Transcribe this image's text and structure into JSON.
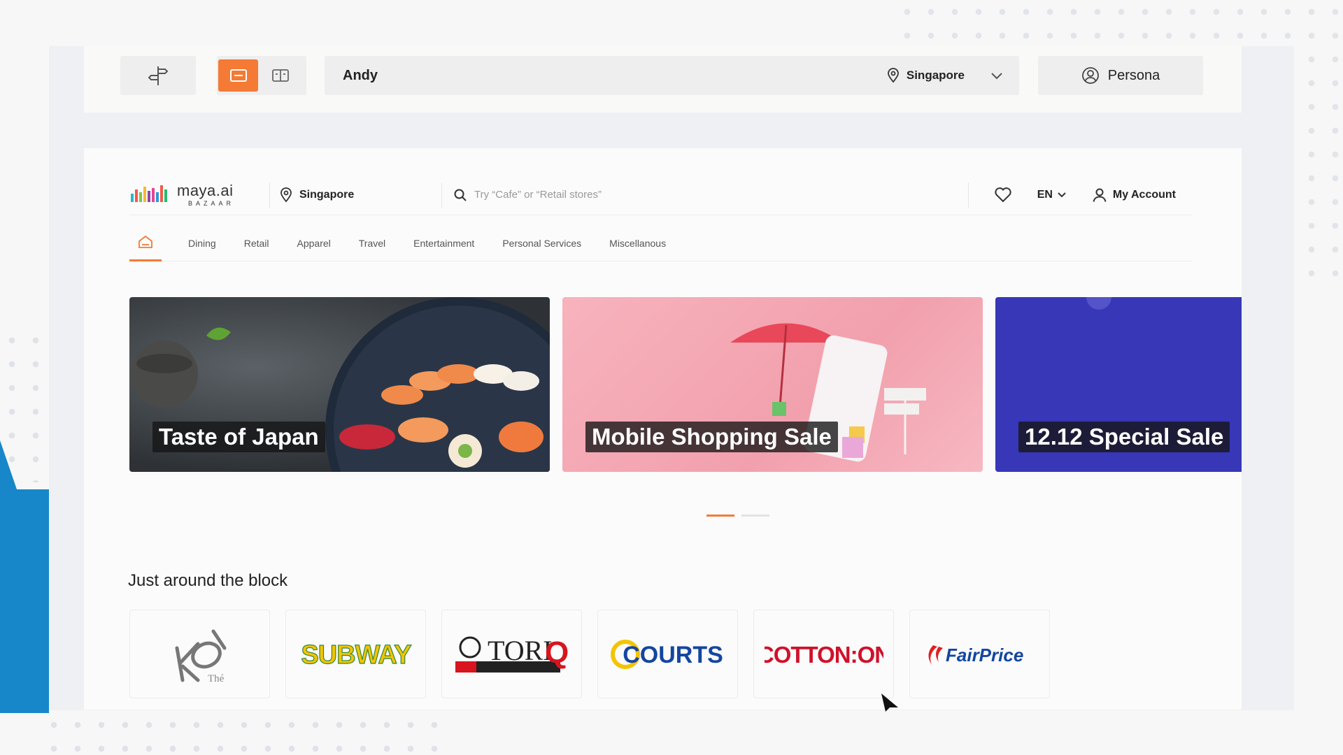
{
  "toolbar": {
    "user_name": "Andy",
    "location": "Singapore",
    "persona_label": "Persona"
  },
  "site": {
    "logo": {
      "name": "maya.ai",
      "sub": "BAZAAR"
    },
    "location": "Singapore",
    "search_placeholder": "Try “Cafe” or “Retail stores”",
    "language": "EN",
    "account_label": "My Account",
    "nav": {
      "items": [
        {
          "label": "Dining"
        },
        {
          "label": "Retail"
        },
        {
          "label": "Apparel"
        },
        {
          "label": "Travel"
        },
        {
          "label": "Entertainment"
        },
        {
          "label": "Personal Services"
        },
        {
          "label": "Miscellanous"
        }
      ]
    },
    "carousel": {
      "slides": [
        {
          "caption": "Taste of Japan"
        },
        {
          "caption": "Mobile Shopping Sale"
        },
        {
          "caption": "12.12 Special Sale"
        }
      ],
      "active_index": 0
    },
    "section_title": "Just around the block",
    "brands": [
      {
        "name": "KOI Thé"
      },
      {
        "name": "SUBWAY"
      },
      {
        "name": "TORIQ"
      },
      {
        "name": "COURTS"
      },
      {
        "name": "COTTON:ON"
      },
      {
        "name": "FairPrice"
      }
    ]
  },
  "colors": {
    "accent": "#f47a35",
    "brand_blue": "#1787c9",
    "sale_blue": "#3737b8",
    "sale_pink": "#f7b3bd"
  }
}
